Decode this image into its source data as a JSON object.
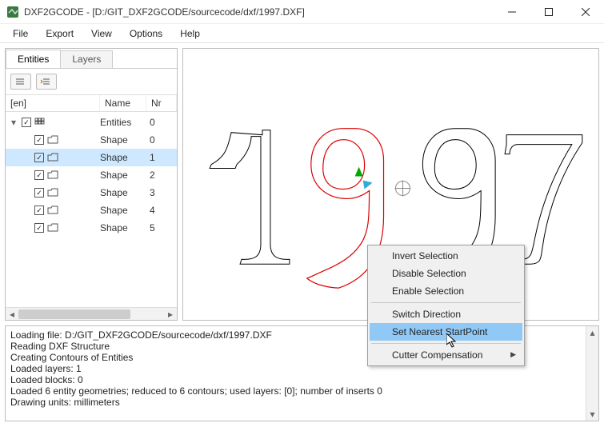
{
  "window": {
    "title": "DXF2GCODE - [D:/GIT_DXF2GCODE/sourcecode/dxf/1997.DXF]"
  },
  "menubar": [
    "File",
    "Export",
    "View",
    "Options",
    "Help"
  ],
  "tabs": {
    "active": "Entities",
    "inactive": "Layers"
  },
  "toolbar": {
    "btn1": "collapse-icon",
    "btn2": "expand-icon"
  },
  "treeHeader": {
    "col1": "[en]",
    "col2": "Name",
    "col3": "Nr"
  },
  "tree": {
    "root": {
      "label": "Entities",
      "nr": "0"
    },
    "rows": [
      {
        "label": "Shape",
        "nr": "0",
        "selected": false
      },
      {
        "label": "Shape",
        "nr": "1",
        "selected": true
      },
      {
        "label": "Shape",
        "nr": "2",
        "selected": false
      },
      {
        "label": "Shape",
        "nr": "3",
        "selected": false
      },
      {
        "label": "Shape",
        "nr": "4",
        "selected": false
      },
      {
        "label": "Shape",
        "nr": "5",
        "selected": false
      }
    ]
  },
  "contextMenu": {
    "items": [
      {
        "label": "Invert Selection"
      },
      {
        "label": "Disable Selection"
      },
      {
        "label": "Enable Selection"
      },
      {
        "sep": true
      },
      {
        "label": "Switch Direction"
      },
      {
        "label": "Set Nearest StartPoint",
        "highlight": true
      },
      {
        "sep": true
      },
      {
        "label": "Cutter Compensation",
        "submenu": true
      }
    ]
  },
  "log": {
    "lines": [
      "Loading file: D:/GIT_DXF2GCODE/sourcecode/dxf/1997.DXF",
      "Reading DXF Structure",
      "Creating Contours of Entities",
      "Loaded layers: 1",
      "Loaded blocks: 0",
      "Loaded 6 entity geometries; reduced to 6 contours; used layers: [0]; number of inserts 0",
      "Drawing units: millimeters"
    ]
  }
}
